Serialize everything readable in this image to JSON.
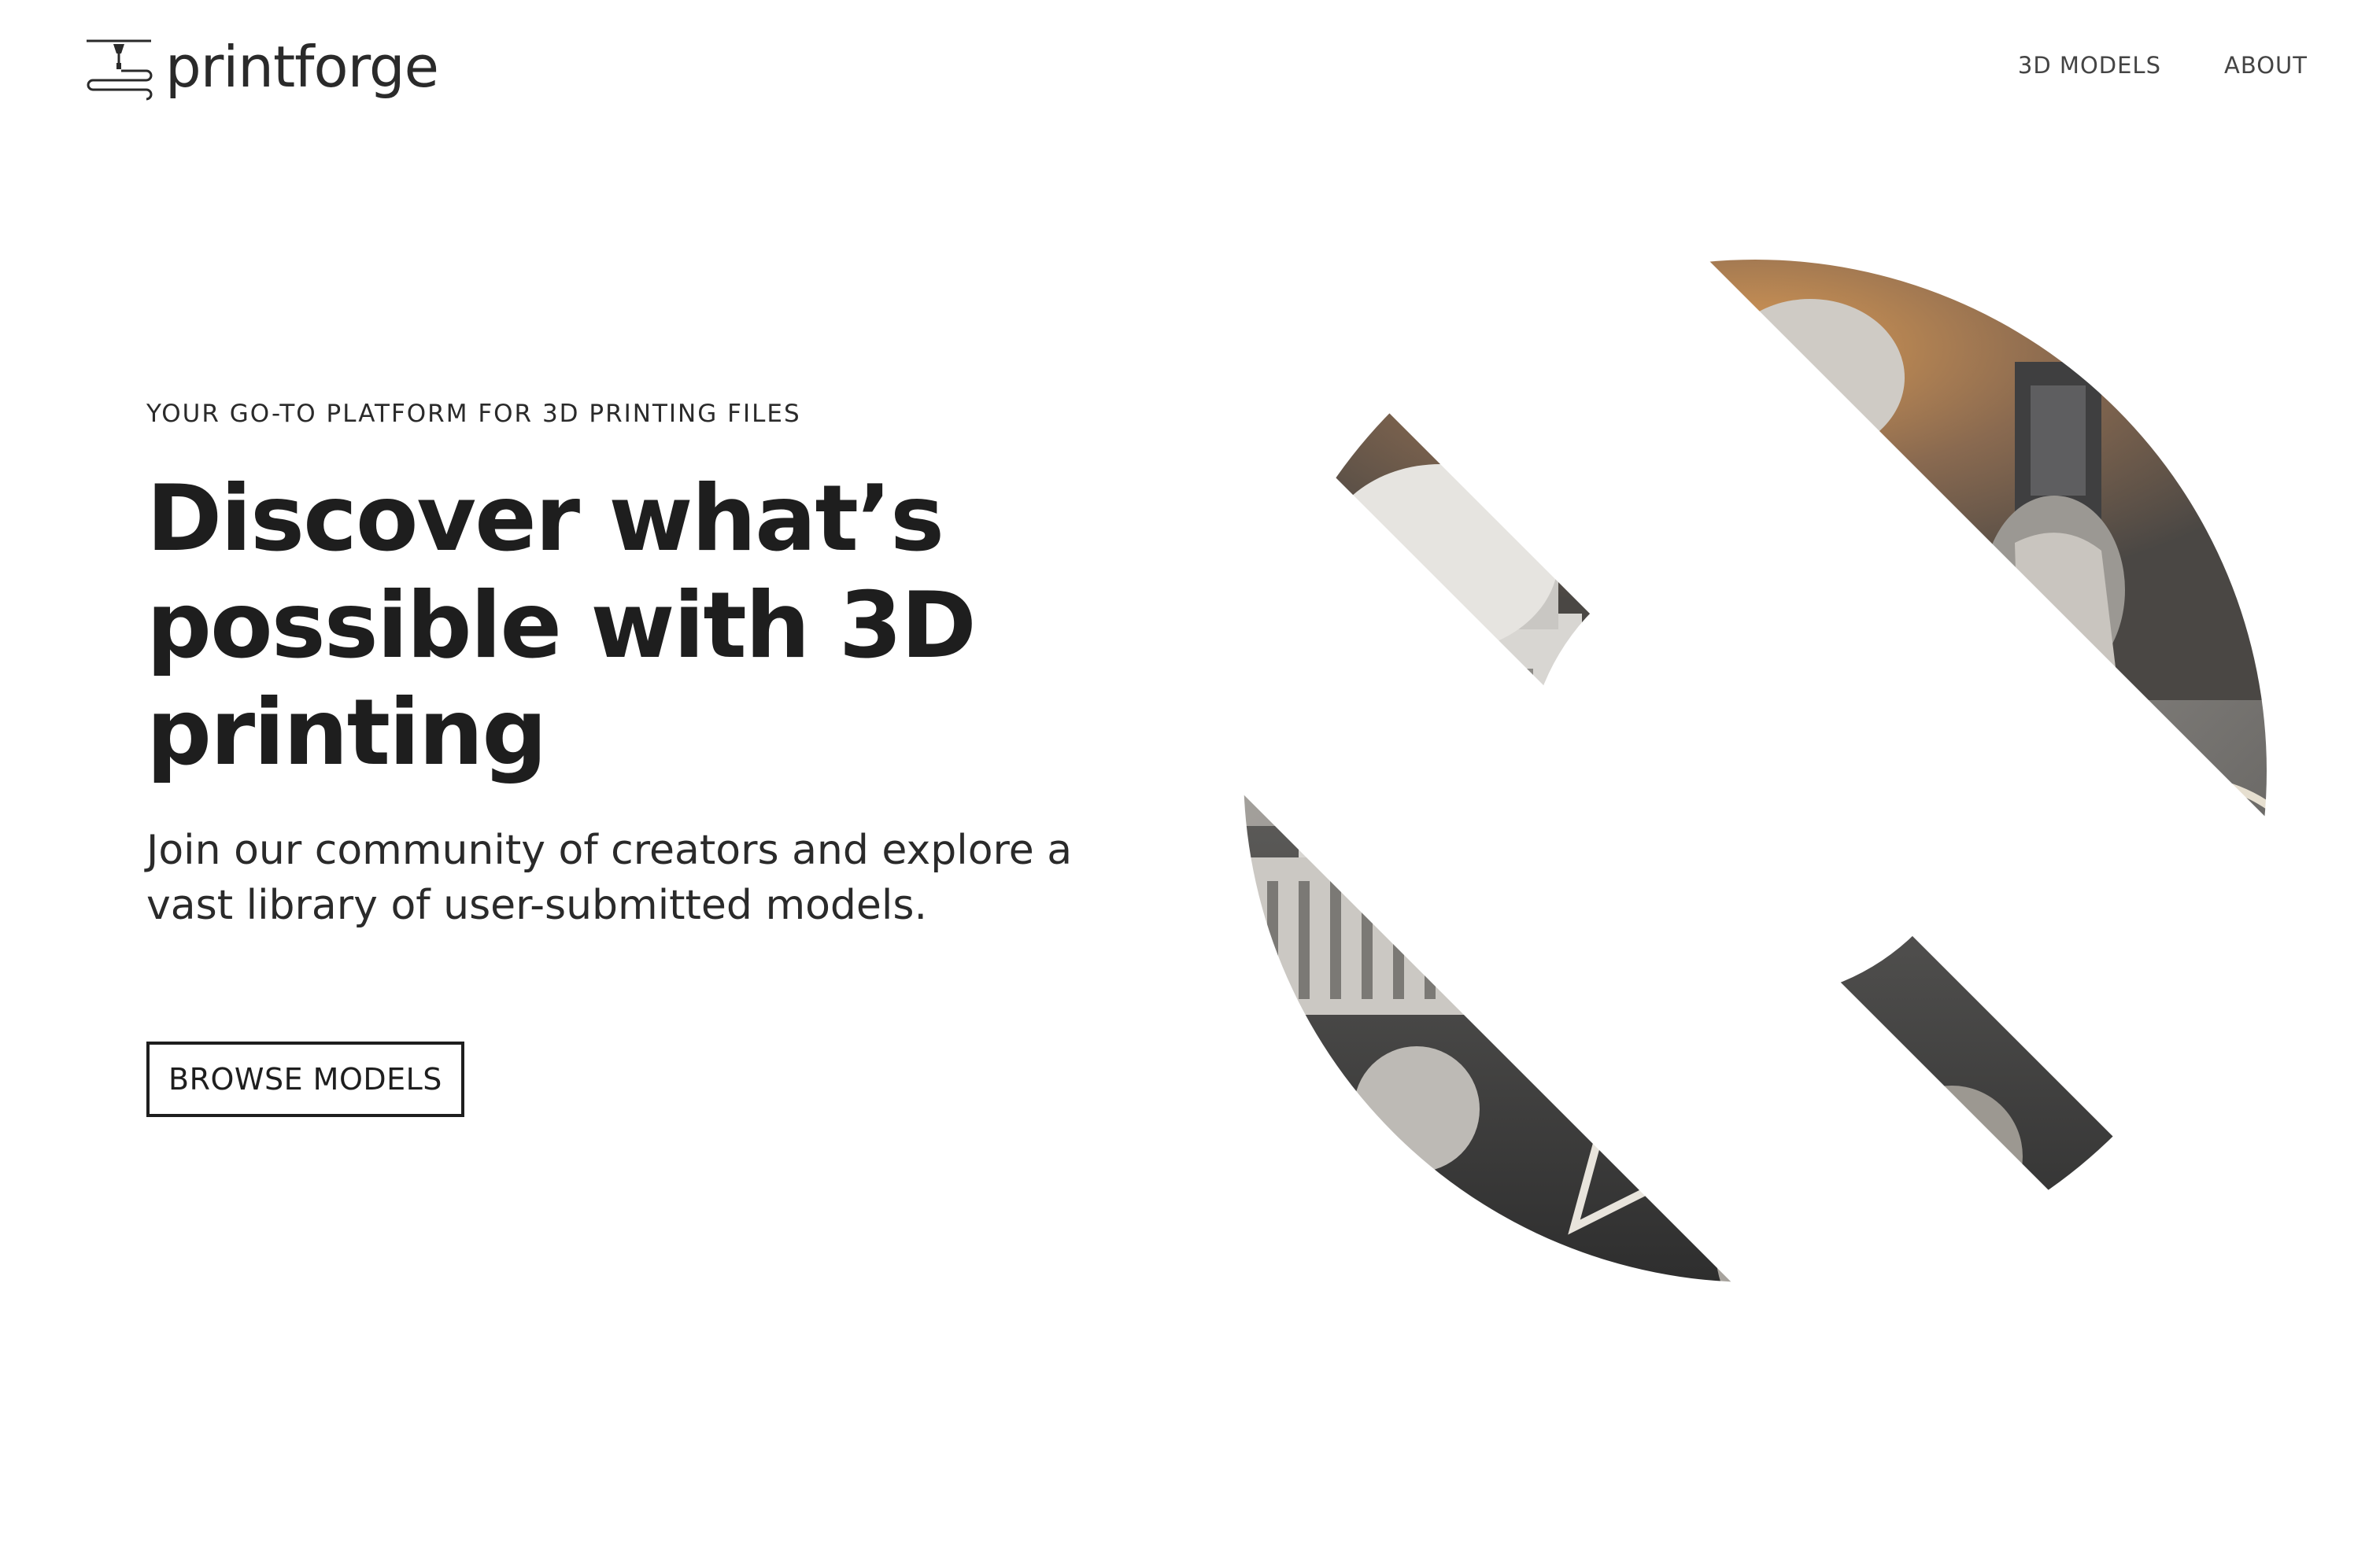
{
  "brand": {
    "name": "printforge",
    "logo_icon": "3d-printer-nozzle-icon"
  },
  "nav": {
    "items": [
      {
        "label": "3D MODELS"
      },
      {
        "label": "ABOUT"
      }
    ]
  },
  "hero": {
    "eyebrow": "YOUR GO-TO PLATFORM FOR 3D PRINTING FILES",
    "headline": "Discover what’s possible with 3D printing",
    "subtext": "Join our community of creators and explore a vast library of user-submitted models.",
    "cta_label": "BROWSE MODELS",
    "image": "3d-printed-models-circular-collage"
  },
  "colors": {
    "text": "#1e1e1e",
    "background": "#ffffff",
    "cta_border": "#1e1e1e"
  }
}
